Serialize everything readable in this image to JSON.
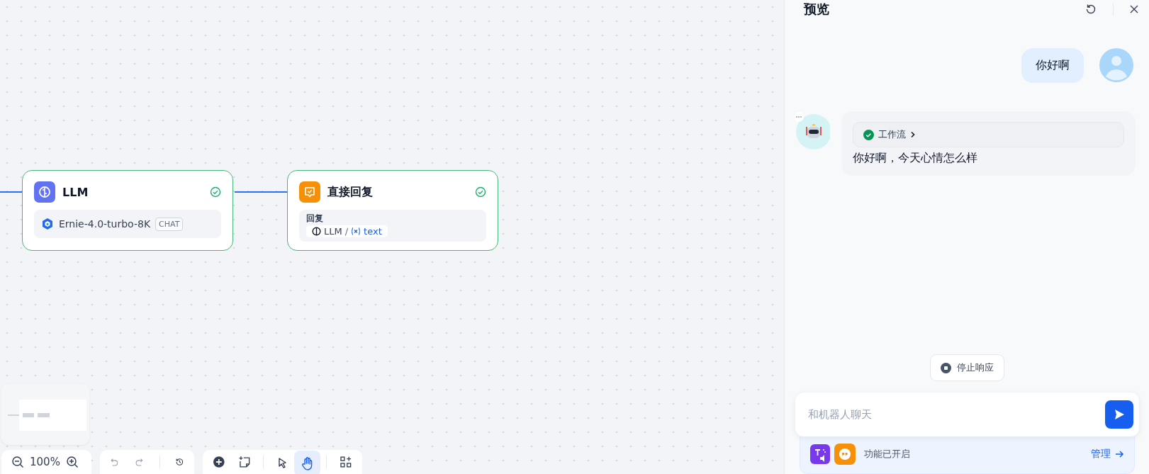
{
  "canvas": {
    "nodes": [
      {
        "kind": "llm",
        "title": "LLM",
        "done": true,
        "model": "Ernie-4.0-turbo-8K",
        "badge": "CHAT"
      },
      {
        "kind": "reply",
        "title": "直接回复",
        "done": true,
        "label": "回复",
        "source": "LLM",
        "separator": "/",
        "variable": "text"
      }
    ],
    "zoom": "100%",
    "history": [
      {
        "kind": "undo",
        "disabled": true
      },
      {
        "kind": "redo",
        "disabled": true
      },
      {
        "kind": "history",
        "disabled": false
      }
    ],
    "tools": [
      {
        "kind": "pointer",
        "selected": false
      },
      {
        "kind": "hand",
        "selected": true
      }
    ]
  },
  "preview": {
    "title": "预览",
    "messages": [
      {
        "kind": "user",
        "text": "你好啊"
      },
      {
        "kind": "bot",
        "workflow": {
          "label": "工作流",
          "done": true
        },
        "text": "你好啊，今天心情怎么样"
      }
    ],
    "stop_label": "停止响应",
    "input": {
      "placeholder": "和机器人聊天"
    },
    "features": {
      "status": "功能已开启",
      "manage": "管理"
    }
  }
}
